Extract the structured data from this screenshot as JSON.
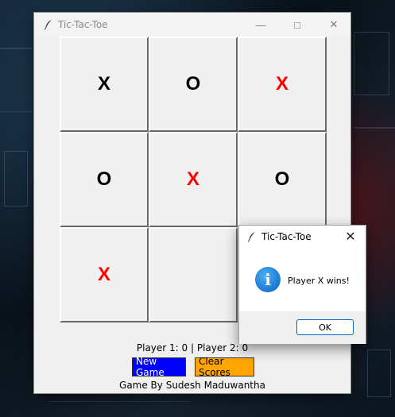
{
  "window": {
    "title": "Tic-Tac-Toe",
    "minimize_glyph": "—",
    "maximize_glyph": "□",
    "close_glyph": "✕"
  },
  "board": {
    "cells": [
      {
        "mark": "X",
        "color": "#000000"
      },
      {
        "mark": "O",
        "color": "#000000"
      },
      {
        "mark": "X",
        "color": "#ff0000"
      },
      {
        "mark": "O",
        "color": "#000000"
      },
      {
        "mark": "X",
        "color": "#ff0000"
      },
      {
        "mark": "O",
        "color": "#000000"
      },
      {
        "mark": "X",
        "color": "#ff0000"
      },
      {
        "mark": "",
        "color": "#000000"
      },
      {
        "mark": "",
        "color": "#000000"
      }
    ]
  },
  "scores_text": "Player 1: 0 | Player 2: 0",
  "buttons": {
    "new_game": "New Game",
    "clear_scores": "Clear Scores",
    "new_game_color": "#0000ff",
    "clear_scores_color": "#ffa500"
  },
  "credit": "Game By Sudesh Maduwantha",
  "dialog": {
    "title": "Tic-Tac-Toe",
    "close_glyph": "✕",
    "icon": "info-icon",
    "icon_glyph": "i",
    "message": "Player X wins!",
    "ok_label": "OK"
  }
}
